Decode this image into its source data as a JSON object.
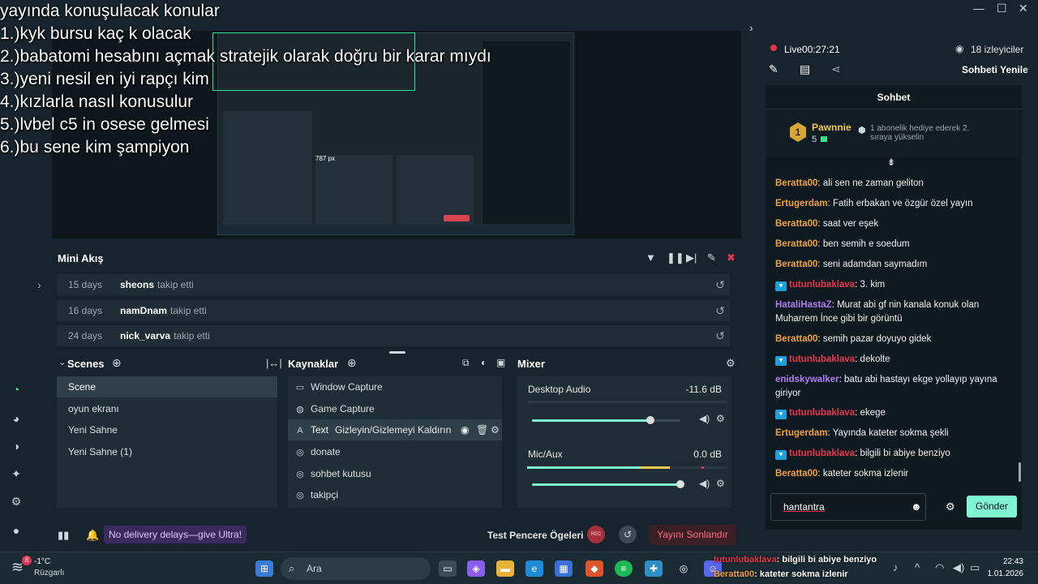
{
  "window": {
    "minimize": "—",
    "maximize": "☐",
    "close": "✕"
  },
  "overlay": {
    "lines": [
      "yayında konuşulacak konular",
      "1.)kyk bursu kaç k olacak",
      "2.)babatomi hesabını açmak stratejik olarak doğru bir karar mıydı",
      "3.)yeni nesil en iyi rapçı kim",
      "4.)kızlarla nasıl konusulur",
      "5.)lvbel c5 in osese gelmesi",
      "6.)bu sene kim şampiyon"
    ],
    "size_readout": "787 px"
  },
  "minifeed": {
    "title": "Mini Akış",
    "rows": [
      {
        "days": "15 days",
        "user": "sheons",
        "action": "takip etti"
      },
      {
        "days": "16 days",
        "user": "namDnam",
        "action": "takip etti"
      },
      {
        "days": "24 days",
        "user": "nick_varva",
        "action": "takip etti"
      }
    ]
  },
  "scenes": {
    "title": "Scenes",
    "items": [
      "Scene",
      "oyun ekranı",
      "Yeni Sahne",
      "Yeni Sahne (1)"
    ]
  },
  "sources": {
    "title": "Kaynaklar",
    "items": [
      {
        "icon": "monitor-icon",
        "label": "Window Capture"
      },
      {
        "icon": "gamepad-icon",
        "label": "Game Capture"
      },
      {
        "icon": "text-icon",
        "label": "Text"
      },
      {
        "icon": "globe-icon",
        "label": "donate"
      },
      {
        "icon": "globe-icon",
        "label": "sohbet kutusu"
      },
      {
        "icon": "globe-icon",
        "label": "takipçi"
      }
    ],
    "tooltip": "Gizleyin/Gizlemeyi Kaldırın"
  },
  "mixer": {
    "title": "Mixer",
    "channels": [
      {
        "name": "Desktop Audio",
        "db": "-11.6 dB",
        "level": 0.8
      },
      {
        "name": "Mic/Aux",
        "db": "0.0 dB",
        "level": 1.0
      }
    ]
  },
  "footer": {
    "promo": "No delivery delays—give Ultra!",
    "test_label": "Test Pencere Ögeleri",
    "rec": "REC",
    "end_stream": "Yayını Sonlandır"
  },
  "live": {
    "status": "Live",
    "time": "00:27:21",
    "viewers": "18 izleyiciler",
    "refresh": "Sohbeti Yenile"
  },
  "chat": {
    "title": "Sohbet",
    "top_user": "Pawnnie",
    "top_rank": "1",
    "top_count": "5",
    "gift_text": "1 abonelik hediye ederek 2. sıraya yükselin",
    "messages": [
      {
        "user": "Beratta00",
        "text": "ali sen ne zaman geliton",
        "color": "#f0a33a",
        "badge": false
      },
      {
        "user": "Ertugerdam",
        "text": "Fatih erbakan ve özgür özel yayın",
        "color": "#f0a33a",
        "badge": false
      },
      {
        "user": "Beratta00",
        "text": "saat ver eşek",
        "color": "#f0a33a",
        "badge": false
      },
      {
        "user": "Beratta00",
        "text": "ben semih e soedum",
        "color": "#f0a33a",
        "badge": false
      },
      {
        "user": "Beratta00",
        "text": "seni adamdan saymadım",
        "color": "#f0a33a",
        "badge": false
      },
      {
        "user": "tutunlubaklava",
        "text": "3. kim",
        "color": "#e8344e",
        "badge": true
      },
      {
        "user": "HataliHastaZ",
        "text": "Murat abi gf nin kanala konuk olan Muharrem İnce gibi bir görüntü",
        "color": "#b07cf0",
        "badge": false
      },
      {
        "user": "Beratta00",
        "text": "semih pazar doyuyo gidek",
        "color": "#f0a33a",
        "badge": false
      },
      {
        "user": "tutunlubaklava",
        "text": "dekolte",
        "color": "#e8344e",
        "badge": true
      },
      {
        "user": "enidskywalker",
        "text": "batu abi hastayı ekge yollayıp yayına giriyor",
        "color": "#b07cf0",
        "badge": false
      },
      {
        "user": "tutunlubaklava",
        "text": "ekege",
        "color": "#e8344e",
        "badge": true
      },
      {
        "user": "Ertugerdam",
        "text": "Yayında kateter sokma şekli",
        "color": "#f0a33a",
        "badge": false
      },
      {
        "user": "tutunlubaklava",
        "text": "bilgili bi abiye benziyo",
        "color": "#e8344e",
        "badge": true
      },
      {
        "user": "Beratta00",
        "text": "kateter sokma izlenir",
        "color": "#f0a33a",
        "badge": false
      }
    ],
    "input_value": "hantantra",
    "send": "Gönder"
  },
  "taskbar": {
    "weather_temp": "-1°C",
    "weather_desc": "Rüzgarlı",
    "weather_badge": "8",
    "search_placeholder": "Ara",
    "notif_line1_user": "tutunlubaklava",
    "notif_line1_text": ": bilgili bi abiye benziyo",
    "notif_line2_user": "Beratta00",
    "notif_line2_text": ": kateter sokma izlenir",
    "time": "22:43",
    "date": "1.01.2026"
  }
}
